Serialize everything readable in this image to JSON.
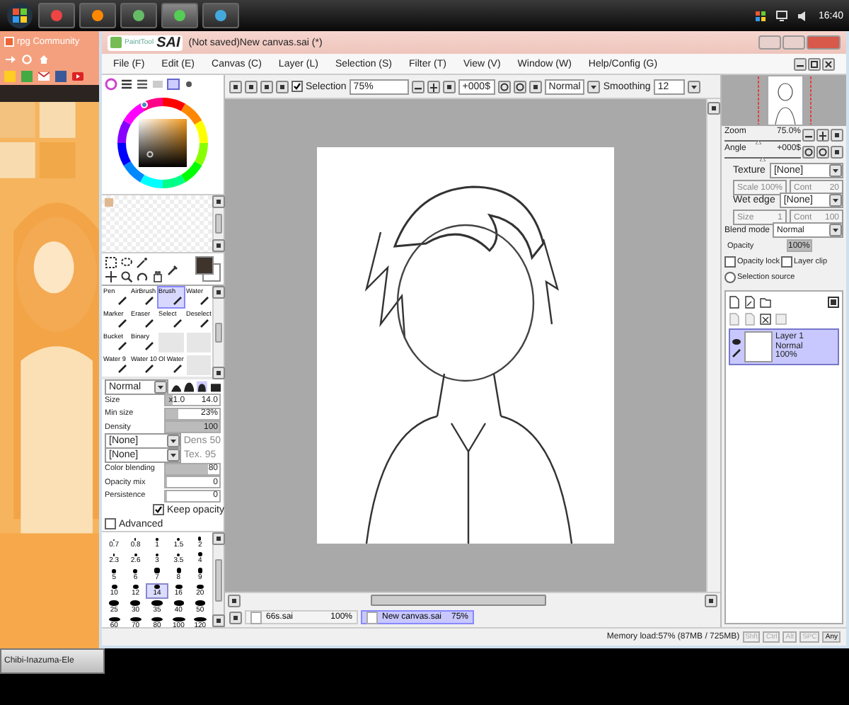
{
  "taskbar": {
    "clock": "16:40"
  },
  "browser": {
    "title": "rpg Community"
  },
  "app": {
    "logo_small": "PaintTool",
    "logo": "SAI",
    "title": "(Not saved)New canvas.sai (*)"
  },
  "menu": [
    "File (F)",
    "Edit (E)",
    "Canvas (C)",
    "Layer (L)",
    "Selection (S)",
    "Filter (T)",
    "View (V)",
    "Window (W)",
    "Help/Config (G)"
  ],
  "toolbar": {
    "selection_label": "Selection",
    "selection_checked": true,
    "zoom": "75%",
    "angle": "+000$",
    "blend": "Normal",
    "smoothing_label": "Smoothing",
    "smoothing": "12"
  },
  "brushes": [
    {
      "kind": "brush",
      "label": "Pen",
      "selected": false
    },
    {
      "kind": "brush",
      "label": "AirBrush",
      "selected": false
    },
    {
      "kind": "brush",
      "label": "Brush",
      "selected": true
    },
    {
      "kind": "brush",
      "label": "Water",
      "selected": false
    },
    {
      "kind": "brush",
      "label": "Marker",
      "selected": false
    },
    {
      "kind": "brush",
      "label": "Eraser",
      "selected": false
    },
    {
      "kind": "brush",
      "label": "Select",
      "selected": false
    },
    {
      "kind": "brush",
      "label": "Deselect",
      "selected": false
    },
    {
      "kind": "brush",
      "label": "Bucket",
      "selected": false
    },
    {
      "kind": "brush",
      "label": "Binary",
      "selected": false
    },
    {
      "kind": "empty"
    },
    {
      "kind": "empty"
    },
    {
      "kind": "brush",
      "label": "Water 9",
      "selected": false
    },
    {
      "kind": "brush",
      "label": "Water 10",
      "selected": false
    },
    {
      "kind": "brush",
      "label": "Ol Water",
      "selected": false
    },
    {
      "kind": "empty"
    }
  ],
  "brush_settings": {
    "mode": "Normal",
    "size_label": "Size",
    "size_multiplier": "x1.0",
    "size": "14.0",
    "size_slider": {
      "level": 0.14
    },
    "min_size": {
      "label": "Min size",
      "value": "23%",
      "level": 0.23
    },
    "density": {
      "label": "Density",
      "value": "100",
      "level": 1
    },
    "shape": {
      "value": "[None]",
      "sub_label": "Dens",
      "sub_value": "50"
    },
    "texture": {
      "value": "[None]",
      "sub_label": "Tex.",
      "sub_value": "95"
    },
    "blending": [
      {
        "label": "Color blending",
        "value": "80",
        "level": 0.8
      },
      {
        "label": "Opacity mix",
        "value": "0",
        "level": 0
      },
      {
        "label": "Persistence",
        "value": "0",
        "level": 0
      }
    ],
    "keep_opacity": {
      "label": "Keep opacity",
      "checked": true
    },
    "advanced": {
      "label": "Advanced",
      "checked": false
    },
    "sizes": [
      {
        "label": "0.7",
        "selected": false
      },
      {
        "label": "0.8",
        "selected": false
      },
      {
        "label": "1",
        "selected": false
      },
      {
        "label": "1.5",
        "selected": false
      },
      {
        "label": "2",
        "selected": false
      },
      {
        "label": "2.3",
        "selected": false
      },
      {
        "label": "2.6",
        "selected": false
      },
      {
        "label": "3",
        "selected": false
      },
      {
        "label": "3.5",
        "selected": false
      },
      {
        "label": "4",
        "selected": false
      },
      {
        "label": "5",
        "selected": false
      },
      {
        "label": "6",
        "selected": false
      },
      {
        "label": "7",
        "selected": false
      },
      {
        "label": "8",
        "selected": false
      },
      {
        "label": "9",
        "selected": false
      },
      {
        "label": "10",
        "selected": false
      },
      {
        "label": "12",
        "selected": false
      },
      {
        "label": "14",
        "selected": true
      },
      {
        "label": "16",
        "selected": false
      },
      {
        "label": "20",
        "selected": false
      },
      {
        "label": "25",
        "selected": false
      },
      {
        "label": "30",
        "selected": false
      },
      {
        "label": "35",
        "selected": false
      },
      {
        "label": "40",
        "selected": false
      },
      {
        "label": "50",
        "selected": false
      },
      {
        "label": "60",
        "selected": false
      },
      {
        "label": "70",
        "selected": false
      },
      {
        "label": "80",
        "selected": false
      },
      {
        "label": "100",
        "selected": false
      },
      {
        "label": "120",
        "selected": false
      }
    ]
  },
  "navigator": {
    "zoom_label": "Zoom",
    "zoom": "75.0%",
    "zoom_slider": {
      "level": 0.45
    },
    "angle_label": "Angle",
    "angle": "+000$",
    "angle_slider": {
      "level": 0.5
    }
  },
  "layer_props": {
    "texture": {
      "label": "Texture",
      "value": "[None]",
      "sub": [
        {
          "label": "Scale",
          "value": "100%"
        },
        {
          "label": "Cont",
          "value": "20"
        }
      ]
    },
    "wet_edge": {
      "label": "Wet edge",
      "value": "[None]",
      "sub": [
        {
          "label": "Size",
          "value": "1"
        },
        {
          "label": "Cont",
          "value": "100"
        }
      ]
    },
    "blend_mode": {
      "label": "Blend mode",
      "value": "Normal"
    },
    "opacity": {
      "label": "Opacity",
      "value": "100%",
      "level": 1
    },
    "checks": [
      {
        "label": "Opacity lock",
        "checked": false
      },
      {
        "label": "Layer clip",
        "checked": false
      }
    ],
    "selection_source": {
      "label": "Selection source",
      "selected": false
    }
  },
  "layers": [
    {
      "name": "Layer 1",
      "mode": "Normal",
      "opacity": "100%",
      "selected": true
    }
  ],
  "documents": [
    {
      "name": "66s.sai",
      "zoom": "100%",
      "selected": false
    },
    {
      "name": "New canvas.sai",
      "zoom": "75%",
      "selected": true
    }
  ],
  "status": {
    "memory": "Memory load:57% (87MB / 725MB)",
    "keys": [
      "Shft",
      "Ctrl",
      "Alt",
      "SPC",
      "Any"
    ]
  },
  "taskbar_item": "Chibi-Inazuma-Ele"
}
